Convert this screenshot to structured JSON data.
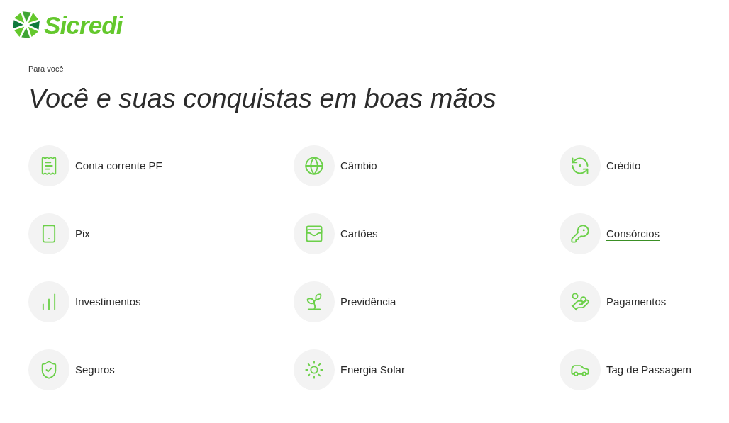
{
  "header": {
    "logo_text": "Sicredi"
  },
  "breadcrumb": "Para você",
  "title": "Você e suas conquistas em boas mãos",
  "products": [
    {
      "label": "Conta corrente PF",
      "hovered": false
    },
    {
      "label": "Câmbio",
      "hovered": false
    },
    {
      "label": "Crédito",
      "hovered": false
    },
    {
      "label": "Pix",
      "hovered": false
    },
    {
      "label": "Cartões",
      "hovered": false
    },
    {
      "label": "Consórcios",
      "hovered": true
    },
    {
      "label": "Investimentos",
      "hovered": false
    },
    {
      "label": "Previdência",
      "hovered": false
    },
    {
      "label": "Pagamentos",
      "hovered": false
    },
    {
      "label": "Seguros",
      "hovered": false
    },
    {
      "label": "Energia Solar",
      "hovered": false
    },
    {
      "label": "Tag de Passagem",
      "hovered": false
    }
  ]
}
